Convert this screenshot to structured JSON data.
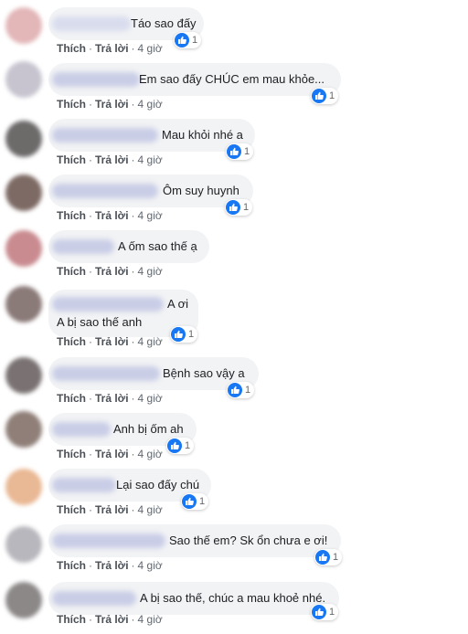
{
  "actions": {
    "like": "Thích",
    "reply": "Trả lời",
    "separator": "·"
  },
  "icons": {
    "like": "like-thumb-icon"
  },
  "colors": {
    "like_blue": "#1877f2",
    "bubble_bg": "#f2f3f5"
  },
  "comments": [
    {
      "text": "Táo sao đấy",
      "time": "4 giờ",
      "likes": "1"
    },
    {
      "text": "Em sao đấy CHÚC em mau khỏe...",
      "time": "4 giờ",
      "likes": "1"
    },
    {
      "text": "Mau khỏi nhé a",
      "time": "4 giờ",
      "likes": "1"
    },
    {
      "text": "Ôm suy huynh",
      "time": "4 giờ",
      "likes": "1"
    },
    {
      "text": "A ốm sao thế ạ",
      "time": "4 giờ"
    },
    {
      "text": "A ơi",
      "text2": "A bị sao thế anh",
      "time": "4 giờ",
      "likes": "1"
    },
    {
      "text": "Bệnh sao vậy a",
      "time": "4 giờ",
      "likes": "1"
    },
    {
      "text": "Anh bị ốm ah",
      "time": "4 giờ",
      "likes": "1"
    },
    {
      "text": "Lại sao đấy chú",
      "time": "4 giờ",
      "likes": "1"
    },
    {
      "text": "Sao thế em? Sk ổn chưa e ơi!",
      "time": "4 giờ",
      "likes": "1"
    },
    {
      "text": "A bị sao thế, chúc a mau khoẻ nhé.",
      "time": "4 giờ",
      "likes": "1"
    }
  ]
}
